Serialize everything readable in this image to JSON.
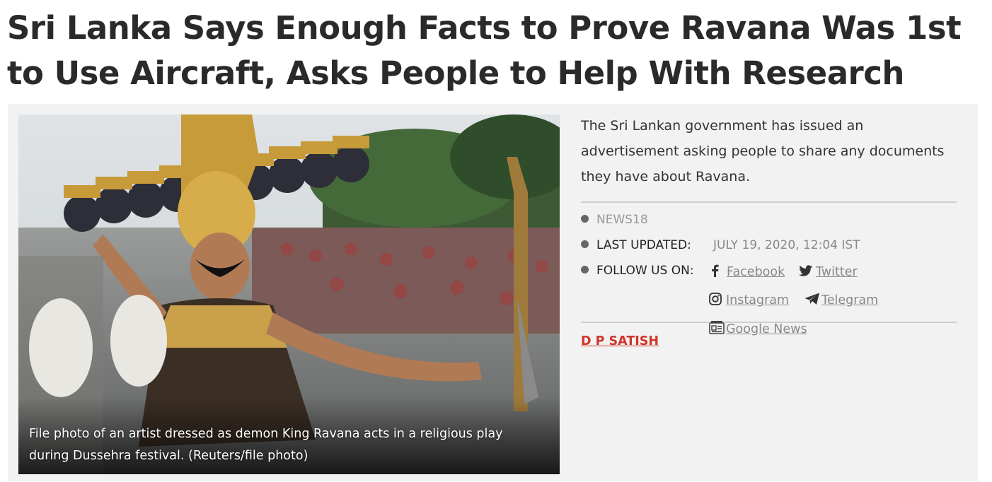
{
  "article": {
    "headline": "Sri Lanka Says Enough Facts to Prove Ravana Was 1st to Use Aircraft, Asks People to Help With Research",
    "summary": "The Sri Lankan government has issued an advertisement asking people to share any documents they have about Ravana.",
    "image": {
      "caption": "File photo of an artist dressed as demon King Ravana acts in a religious play during Dussehra festival. (Reuters/file photo)"
    },
    "meta": {
      "source": "NEWS18",
      "last_updated_label": "LAST UPDATED:",
      "last_updated_value": "JULY 19, 2020, 12:04 IST",
      "follow_label": "FOLLOW US ON:"
    },
    "social": [
      {
        "name": "Facebook",
        "icon": "facebook-icon"
      },
      {
        "name": "Twitter",
        "icon": "twitter-icon"
      },
      {
        "name": "Instagram",
        "icon": "instagram-icon"
      },
      {
        "name": "Telegram",
        "icon": "telegram-icon"
      },
      {
        "name": "Google News",
        "icon": "google-news-icon"
      }
    ],
    "author": "D P SATISH"
  },
  "colors": {
    "author": "#d0352b",
    "panel_bg": "#f2f2f2",
    "headline": "#2a2a2a"
  }
}
